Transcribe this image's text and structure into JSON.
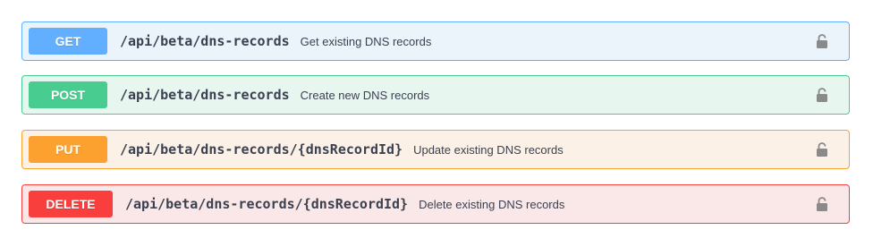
{
  "operations": [
    {
      "method": "GET",
      "path": "/api/beta/dns-records",
      "summary": "Get existing DNS records",
      "lock_icon": "lock-icon",
      "color": "#61affe"
    },
    {
      "method": "POST",
      "path": "/api/beta/dns-records",
      "summary": "Create new DNS records",
      "lock_icon": "lock-icon",
      "color": "#49cc90"
    },
    {
      "method": "PUT",
      "path": "/api/beta/dns-records/{dnsRecordId}",
      "summary": "Update existing DNS records",
      "lock_icon": "lock-icon",
      "color": "#fca130"
    },
    {
      "method": "DELETE",
      "path": "/api/beta/dns-records/{dnsRecordId}",
      "summary": "Delete existing DNS records",
      "lock_icon": "lock-icon",
      "color": "#f93e3e"
    }
  ]
}
